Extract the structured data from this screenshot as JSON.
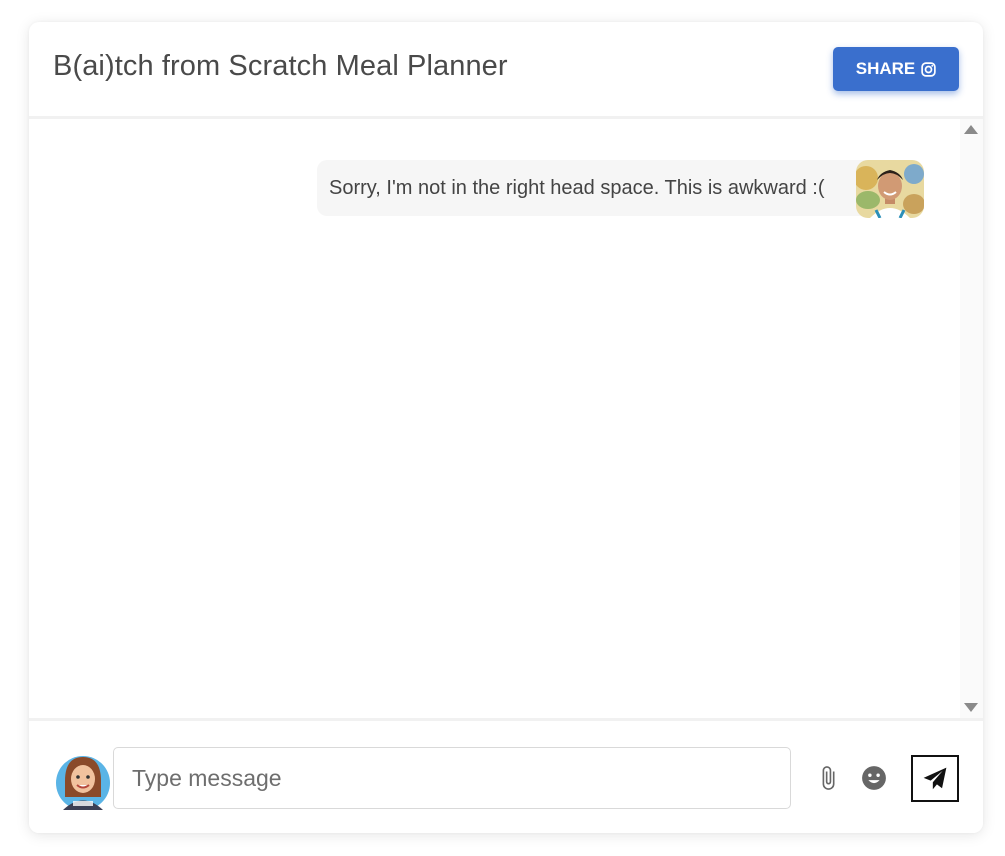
{
  "header": {
    "title": "B(ai)tch from Scratch Meal Planner",
    "share_label": "SHARE",
    "share_icon": "instagram-icon"
  },
  "messages": [
    {
      "text": "Sorry, I'm not in the right head space. This is awkward :(",
      "sender": "bot",
      "avatar": "chef-avatar"
    }
  ],
  "composer": {
    "placeholder": "Type message",
    "value": "",
    "user_avatar": "user-avatar",
    "attach_icon": "paperclip-icon",
    "emoji_icon": "smiley-icon",
    "send_icon": "paper-plane-icon"
  },
  "colors": {
    "accent": "#3a6fcd",
    "title_text": "#4a4a4a",
    "bubble_bg": "#f6f6f6"
  }
}
